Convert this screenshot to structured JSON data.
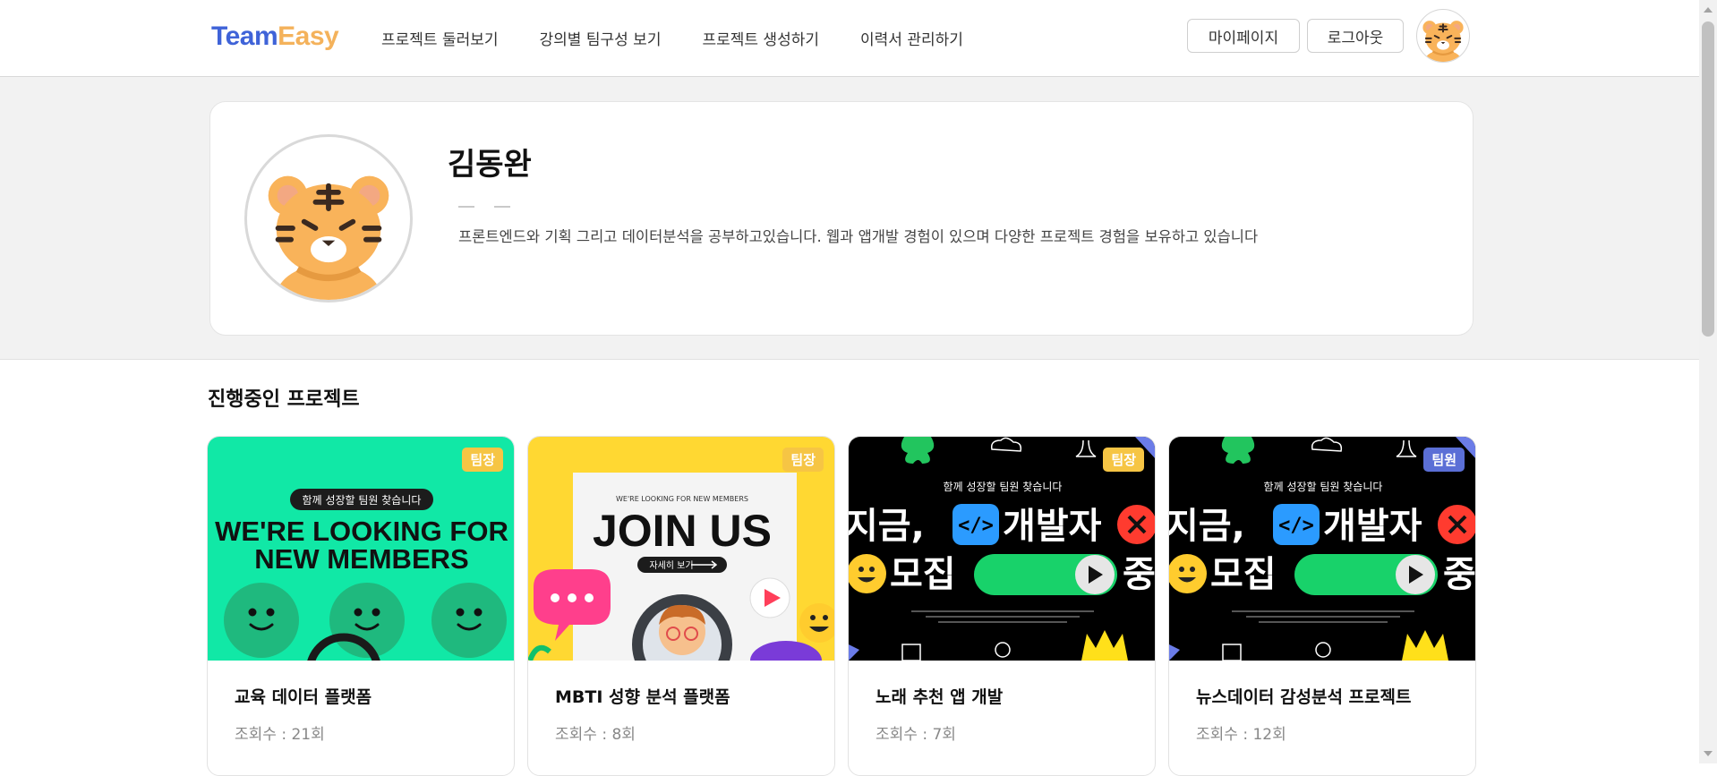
{
  "header": {
    "logo": {
      "part1": "Team",
      "part2": "Easy"
    },
    "nav": [
      {
        "label": "프로젝트 둘러보기"
      },
      {
        "label": "강의별 팀구성 보기"
      },
      {
        "label": "프로젝트 생성하기"
      },
      {
        "label": "이력서 관리하기"
      }
    ],
    "mypage_label": "마이페이지",
    "logout_label": "로그아웃",
    "avatar_icon": "tiger-avatar-icon"
  },
  "profile": {
    "name": "김동완",
    "bio": "프론트엔드와 기획 그리고 데이터분석을 공부하고있습니다. 웹과 앱개발 경험이 있으며 다양한 프로젝트 경험을 보유하고 있습니다",
    "avatar_icon": "tiger-avatar-icon"
  },
  "projects": {
    "section_title": "진행중인 프로젝트",
    "items": [
      {
        "title": "교육 데이터 플랫폼",
        "views": "조회수 : 21회",
        "role": "팀장",
        "image": {
          "pill": "함께 성장할 팀원 찾습니다",
          "line1": "WE'RE LOOKING FOR",
          "line2": "NEW MEMBERS"
        }
      },
      {
        "title": "MBTI 성향 분석 플랫폼",
        "views": "조회수 : 8회",
        "role": "팀장",
        "image": {
          "small": "WE'RE LOOKING FOR NEW MEMBERS",
          "main": "JOIN US",
          "button": "자세히 보기"
        }
      },
      {
        "title": "노래 추천 앱 개발",
        "views": "조회수 : 7회",
        "role": "팀장",
        "image": {
          "top": "함께 성장할 팀원 찾습니다",
          "line1a": "지금,",
          "line1b": "개발자",
          "line2a": "모집",
          "line2b": "중"
        }
      },
      {
        "title": "뉴스데이터 감성분석 프로젝트",
        "views": "조회수 : 12회",
        "role": "팀원",
        "image": {
          "top": "함께 성장할 팀원 찾습니다",
          "line1a": "지금,",
          "line1b": "개발자",
          "line2a": "모집",
          "line2b": "중"
        }
      }
    ]
  },
  "colors": {
    "logo_team": "#3f63d8",
    "logo_easy": "#f4b25b",
    "badge_leader": "#f6c544",
    "badge_member": "#5b6fd6",
    "card1_bg": "#11e8a6",
    "card2_bg": "#ffd832",
    "card34_bg": "#000000"
  }
}
